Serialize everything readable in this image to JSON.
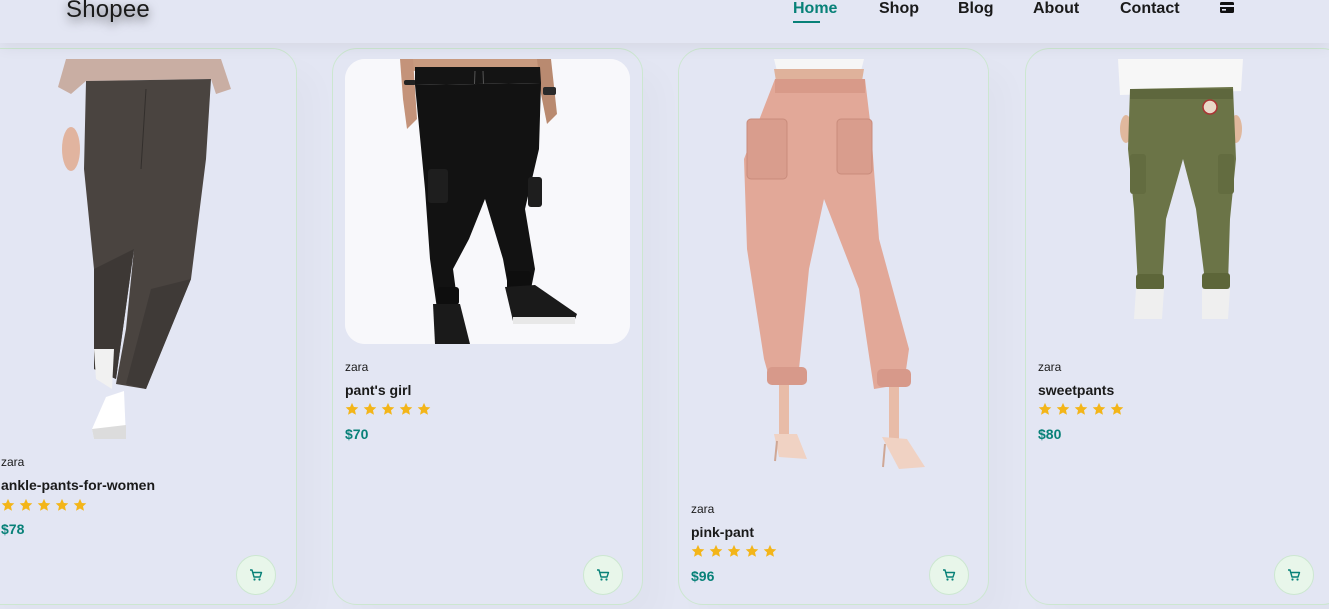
{
  "header": {
    "logo": "Shopee",
    "nav": [
      {
        "label": "Home",
        "active": true
      },
      {
        "label": "Shop",
        "active": false
      },
      {
        "label": "Blog",
        "active": false
      },
      {
        "label": "About",
        "active": false
      },
      {
        "label": "Contact",
        "active": false
      }
    ],
    "cart_icon": "cart-icon"
  },
  "products": [
    {
      "brand": "zara",
      "name": "ankle-pants-for-women",
      "rating": 5,
      "price": "$78",
      "image": "dark-grey-ankle-pants"
    },
    {
      "brand": "zara",
      "name": "pant's girl",
      "rating": 5,
      "price": "$70",
      "image": "black-cargo-joggers"
    },
    {
      "brand": "zara",
      "name": "pink-pant",
      "rating": 5,
      "price": "$96",
      "image": "pink-jogger-pants"
    },
    {
      "brand": "zara",
      "name": "sweetpants",
      "rating": 5,
      "price": "$80",
      "image": "olive-cargo-pants"
    }
  ],
  "colors": {
    "accent": "#088178",
    "background": "#e3e6f3",
    "star": "#f3b519",
    "card_border": "#cce7d0",
    "cart_button_bg": "#e8f6ea"
  }
}
